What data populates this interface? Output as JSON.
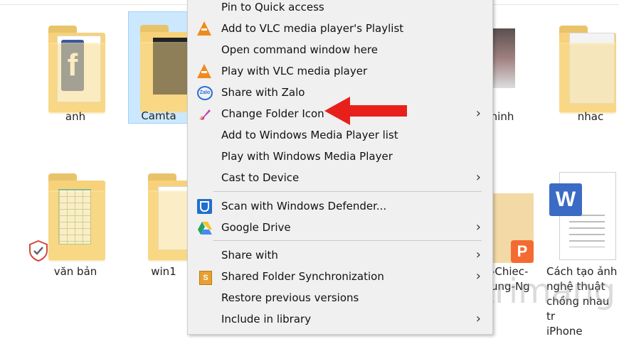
{
  "desktop": {
    "items": [
      {
        "label": "anh"
      },
      {
        "label": "Camta"
      },
      {
        "label": "hinh"
      },
      {
        "label": "nhac"
      },
      {
        "label": "văn bản"
      },
      {
        "label": "win1"
      }
    ],
    "pdf_caption_lines": [
      "-Chiec-",
      "ung-Ng"
    ],
    "doc_caption_lines": [
      "Cách tạo ảnh",
      "nghệ thuật",
      "chồng nhau tr",
      "iPhone"
    ],
    "watermark": "uantrimang"
  },
  "context_menu": {
    "items": [
      {
        "label": "Pin to Quick access",
        "icon": "none",
        "submenu": false
      },
      {
        "label": "Add to VLC media player's Playlist",
        "icon": "vlc-icon",
        "submenu": false
      },
      {
        "label": "Open command window here",
        "icon": "none",
        "submenu": false
      },
      {
        "label": "Play with VLC media player",
        "icon": "vlc-icon",
        "submenu": false
      },
      {
        "label": "Share with Zalo",
        "icon": "zalo-icon",
        "submenu": false
      },
      {
        "label": "Change Folder Icon",
        "icon": "paintbrush-icon",
        "submenu": true
      },
      {
        "label": "Add to Windows Media Player list",
        "icon": "none",
        "submenu": false
      },
      {
        "label": "Play with Windows Media Player",
        "icon": "none",
        "submenu": false
      },
      {
        "label": "Cast to Device",
        "icon": "none",
        "submenu": true
      },
      {
        "label": "Scan with Windows Defender...",
        "icon": "windows-defender-icon",
        "submenu": false
      },
      {
        "label": "Google Drive",
        "icon": "google-drive-icon",
        "submenu": true
      },
      {
        "label": "Share with",
        "icon": "none",
        "submenu": true
      },
      {
        "label": "Shared Folder Synchronization",
        "icon": "shared-folder-sync-icon",
        "submenu": true
      },
      {
        "label": "Restore previous versions",
        "icon": "none",
        "submenu": false
      },
      {
        "label": "Include in library",
        "icon": "none",
        "submenu": true
      }
    ],
    "chevron": "›"
  },
  "colors": {
    "selection": "#cce8ff",
    "menu_bg": "#f0f0f0",
    "arrow": "#e8201c",
    "folder": "#f7d27b"
  }
}
